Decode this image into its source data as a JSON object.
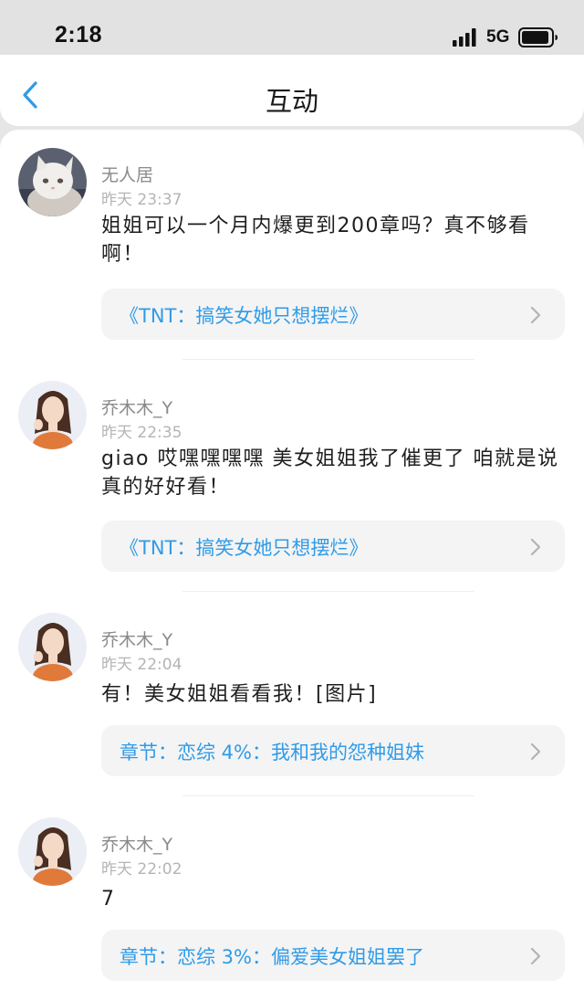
{
  "status_bar": {
    "time": "2:18",
    "network": "5G",
    "icons": [
      "signal-icon",
      "battery-icon"
    ]
  },
  "header": {
    "title": "互动",
    "back_icon": "chevron-left-icon"
  },
  "colors": {
    "accent": "#2f9be8",
    "background": "#ffffff",
    "card_background": "#f4f4f4",
    "secondary_text": "#8a8a8a"
  },
  "comments": [
    {
      "username": "无人居",
      "time": "昨天 23:37",
      "text": "姐姐可以一个月内爆更到200章吗？真不够看啊！",
      "reference": "《TNT：搞笑女她只想摆烂》",
      "avatar": "cat-avatar"
    },
    {
      "username": "乔木木_Y",
      "time": "昨天 22:35",
      "text": "giao 哎嘿嘿嘿嘿 美女姐姐我了催更了 咱就是说真的好好看！",
      "reference": "《TNT：搞笑女她只想摆烂》",
      "avatar": "woman-avatar"
    },
    {
      "username": "乔木木_Y",
      "time": "昨天 22:04",
      "text": "有！美女姐姐看看我！[图片]",
      "reference": "章节：恋综 4%：我和我的怨种姐妹",
      "avatar": "woman-avatar"
    },
    {
      "username": "乔木木_Y",
      "time": "昨天 22:02",
      "text": "7",
      "reference": "章节：恋综 3%：偏爱美女姐姐罢了",
      "avatar": "woman-avatar"
    }
  ]
}
